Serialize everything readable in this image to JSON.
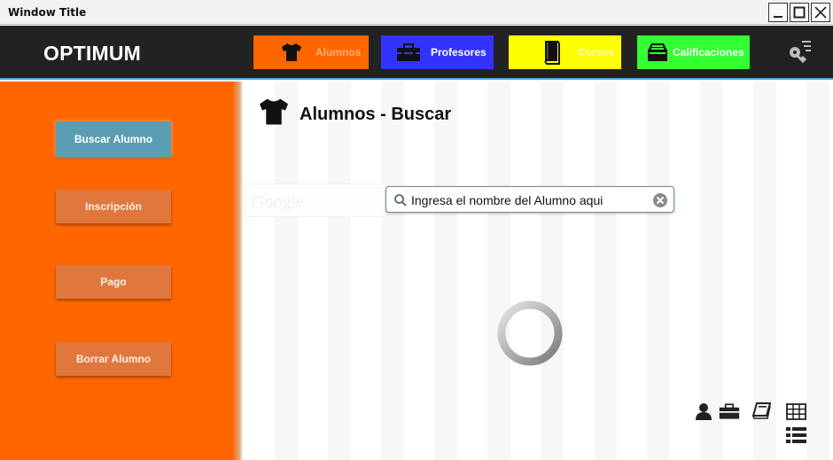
{
  "window": {
    "title": "Window Title"
  },
  "header": {
    "brand": "OPTIMUM",
    "nav": [
      {
        "label": "Alumnos",
        "icon": "tshirt-icon",
        "color": "#ff6600"
      },
      {
        "label": "Profesores",
        "icon": "briefcase-icon",
        "color": "#3333ff"
      },
      {
        "label": "Cursos",
        "icon": "book-icon",
        "color": "#ffff00"
      },
      {
        "label": "Calificaciones",
        "icon": "inbox-tray-icon",
        "color": "#33ff33"
      }
    ],
    "settings_icon": "key-menu-icon"
  },
  "sidebar": {
    "color": "#ff6600",
    "items": [
      {
        "label": "Buscar Alumno",
        "active": true
      },
      {
        "label": "Inscripción",
        "active": false
      },
      {
        "label": "Pago",
        "active": false
      },
      {
        "label": "Borrar Alumno",
        "active": false
      }
    ]
  },
  "main": {
    "title": "Alumnos - Buscar",
    "title_icon": "tshirt-icon",
    "ghost_logo": "Google",
    "search": {
      "value": "Ingresa el nombre del Alumno aqui",
      "placeholder": ""
    },
    "loading_icon": "loading-spinner-icon",
    "bottom_icons": [
      "user-icon",
      "briefcase-icon",
      "book-icon",
      "grid-view-icon",
      "list-view-icon"
    ]
  }
}
